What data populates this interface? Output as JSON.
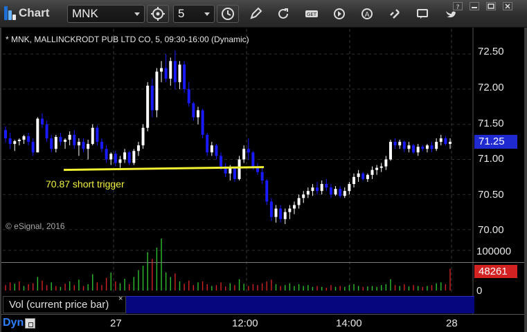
{
  "toolbar": {
    "title": "Chart",
    "symbol": "MNK",
    "interval": "5"
  },
  "colors": {
    "up_candle": "#ffffff",
    "down_candle": "#1a1aff",
    "trigger_line": "#f2f230",
    "vol_up": "#2fbf2f",
    "vol_down": "#d22222",
    "price_box": "#1f2bd0"
  },
  "chart": {
    "title": "* MNK, MALLINCKRODT PUB LTD CO, 5, 09:30-16:00 (Dynamic)",
    "watermark": "© eSignal, 2016",
    "annotation": "70.87 short trigger",
    "current_price": "71.25",
    "current_volume": "48261",
    "volume_panel_label": "Vol (current price bar)",
    "close_x": "×",
    "dyn_label": "Dyn",
    "price_ticks": [
      "72.50",
      "72.00",
      "71.50",
      "71.00",
      "70.50",
      "70.00"
    ],
    "volume_ticks": [
      "100000",
      "0"
    ],
    "x_ticks": [
      "27",
      "12:00",
      "14:00",
      "28"
    ]
  },
  "chart_data": {
    "type": "candlestick",
    "symbol": "MNK",
    "ylim": [
      70.0,
      72.6
    ],
    "trigger_level": 70.87,
    "bars": [
      [
        71.42,
        71.47,
        71.24,
        71.3
      ],
      [
        71.3,
        71.38,
        71.15,
        71.22
      ],
      [
        71.22,
        71.28,
        71.12,
        71.26
      ],
      [
        71.26,
        71.3,
        71.2,
        71.28
      ],
      [
        71.28,
        71.35,
        71.22,
        71.33
      ],
      [
        71.33,
        71.38,
        71.2,
        71.25
      ],
      [
        71.25,
        71.3,
        71.05,
        71.1
      ],
      [
        71.1,
        71.6,
        71.1,
        71.58
      ],
      [
        71.58,
        71.66,
        71.45,
        71.5
      ],
      [
        71.5,
        71.55,
        71.25,
        71.3
      ],
      [
        71.3,
        71.35,
        71.1,
        71.15
      ],
      [
        71.15,
        71.35,
        71.1,
        71.32
      ],
      [
        71.32,
        71.38,
        71.2,
        71.25
      ],
      [
        71.25,
        71.3,
        71.15,
        71.28
      ],
      [
        71.28,
        71.4,
        71.2,
        71.35
      ],
      [
        71.35,
        71.42,
        71.15,
        71.2
      ],
      [
        71.2,
        71.3,
        71.05,
        71.25
      ],
      [
        71.25,
        71.3,
        71.1,
        71.15
      ],
      [
        71.15,
        71.28,
        71.0,
        71.22
      ],
      [
        71.22,
        71.5,
        71.2,
        71.45
      ],
      [
        71.45,
        71.48,
        71.2,
        71.25
      ],
      [
        71.25,
        71.3,
        71.1,
        71.15
      ],
      [
        71.15,
        71.2,
        70.95,
        71.0
      ],
      [
        71.0,
        71.1,
        70.92,
        71.08
      ],
      [
        71.08,
        71.12,
        70.9,
        70.95
      ],
      [
        70.95,
        71.05,
        70.88,
        71.0
      ],
      [
        71.0,
        71.15,
        70.95,
        71.1
      ],
      [
        71.1,
        71.12,
        70.92,
        70.95
      ],
      [
        70.95,
        71.15,
        70.92,
        71.12
      ],
      [
        71.12,
        71.25,
        71.05,
        71.2
      ],
      [
        71.2,
        71.5,
        71.15,
        71.45
      ],
      [
        71.45,
        72.1,
        71.4,
        72.05
      ],
      [
        72.05,
        72.15,
        71.6,
        71.7
      ],
      [
        71.7,
        72.3,
        71.6,
        72.25
      ],
      [
        72.25,
        72.4,
        72.1,
        72.3
      ],
      [
        72.3,
        72.5,
        72.1,
        72.15
      ],
      [
        72.15,
        72.45,
        72.05,
        72.4
      ],
      [
        72.4,
        72.55,
        72.0,
        72.1
      ],
      [
        72.1,
        72.4,
        72.0,
        72.35
      ],
      [
        72.35,
        72.4,
        71.95,
        72.0
      ],
      [
        72.0,
        72.1,
        71.75,
        71.8
      ],
      [
        71.8,
        71.82,
        71.55,
        71.6
      ],
      [
        71.6,
        71.75,
        71.5,
        71.7
      ],
      [
        71.7,
        71.72,
        71.3,
        71.35
      ],
      [
        71.35,
        71.38,
        71.05,
        71.1
      ],
      [
        71.1,
        71.25,
        71.05,
        71.2
      ],
      [
        71.2,
        71.22,
        71.0,
        71.05
      ],
      [
        71.05,
        71.1,
        70.85,
        70.9
      ],
      [
        70.9,
        70.95,
        70.75,
        70.8
      ],
      [
        70.8,
        70.92,
        70.7,
        70.88
      ],
      [
        70.88,
        70.9,
        70.68,
        70.72
      ],
      [
        70.72,
        71.05,
        70.7,
        71.0
      ],
      [
        71.0,
        71.2,
        70.95,
        71.15
      ],
      [
        71.15,
        71.3,
        71.0,
        71.1
      ],
      [
        71.1,
        71.12,
        70.85,
        70.9
      ],
      [
        70.9,
        70.95,
        70.78,
        70.82
      ],
      [
        70.82,
        70.88,
        70.65,
        70.7
      ],
      [
        70.7,
        70.72,
        70.35,
        70.4
      ],
      [
        70.4,
        70.45,
        70.12,
        70.18
      ],
      [
        70.18,
        70.35,
        70.1,
        70.3
      ],
      [
        70.3,
        70.35,
        70.1,
        70.15
      ],
      [
        70.15,
        70.3,
        70.08,
        70.25
      ],
      [
        70.25,
        70.35,
        70.15,
        70.3
      ],
      [
        70.3,
        70.4,
        70.22,
        70.35
      ],
      [
        70.35,
        70.5,
        70.3,
        70.45
      ],
      [
        70.45,
        70.55,
        70.38,
        70.5
      ],
      [
        70.5,
        70.6,
        70.45,
        70.55
      ],
      [
        70.55,
        70.65,
        70.48,
        70.6
      ],
      [
        70.6,
        70.68,
        70.5,
        70.55
      ],
      [
        70.55,
        70.7,
        70.5,
        70.65
      ],
      [
        70.65,
        70.72,
        70.55,
        70.6
      ],
      [
        70.6,
        70.65,
        70.45,
        70.5
      ],
      [
        70.5,
        70.62,
        70.48,
        70.58
      ],
      [
        70.58,
        70.62,
        70.45,
        70.48
      ],
      [
        70.48,
        70.6,
        70.45,
        70.55
      ],
      [
        70.55,
        70.68,
        70.5,
        70.65
      ],
      [
        70.65,
        70.8,
        70.6,
        70.75
      ],
      [
        70.75,
        70.85,
        70.68,
        70.8
      ],
      [
        70.8,
        70.82,
        70.7,
        70.72
      ],
      [
        70.72,
        70.8,
        70.68,
        70.78
      ],
      [
        70.78,
        70.9,
        70.72,
        70.85
      ],
      [
        70.85,
        70.92,
        70.78,
        70.88
      ],
      [
        70.88,
        70.95,
        70.82,
        70.9
      ],
      [
        70.9,
        71.05,
        70.85,
        71.0
      ],
      [
        71.0,
        71.28,
        70.98,
        71.25
      ],
      [
        71.25,
        71.3,
        71.15,
        71.2
      ],
      [
        71.2,
        71.28,
        71.15,
        71.25
      ],
      [
        71.25,
        71.27,
        71.1,
        71.15
      ],
      [
        71.15,
        71.25,
        71.1,
        71.2
      ],
      [
        71.2,
        71.22,
        71.08,
        71.1
      ],
      [
        71.1,
        71.22,
        71.05,
        71.18
      ],
      [
        71.18,
        71.2,
        71.12,
        71.15
      ],
      [
        71.15,
        71.22,
        71.1,
        71.2
      ],
      [
        71.2,
        71.25,
        71.1,
        71.15
      ],
      [
        71.15,
        71.3,
        71.12,
        71.25
      ],
      [
        71.25,
        71.35,
        71.2,
        71.3
      ],
      [
        71.3,
        71.33,
        71.2,
        71.22
      ],
      [
        71.22,
        71.3,
        71.15,
        71.25
      ]
    ],
    "volume": [
      [
        12000,
        "d"
      ],
      [
        18000,
        "d"
      ],
      [
        15000,
        "u"
      ],
      [
        20000,
        "d"
      ],
      [
        10000,
        "u"
      ],
      [
        14000,
        "d"
      ],
      [
        16000,
        "d"
      ],
      [
        30000,
        "u"
      ],
      [
        22000,
        "d"
      ],
      [
        12000,
        "d"
      ],
      [
        18000,
        "u"
      ],
      [
        10000,
        "d"
      ],
      [
        8000,
        "u"
      ],
      [
        15000,
        "d"
      ],
      [
        20000,
        "u"
      ],
      [
        12000,
        "d"
      ],
      [
        24000,
        "u"
      ],
      [
        10000,
        "d"
      ],
      [
        14000,
        "u"
      ],
      [
        36000,
        "u"
      ],
      [
        18000,
        "d"
      ],
      [
        12000,
        "d"
      ],
      [
        28000,
        "d"
      ],
      [
        40000,
        "u"
      ],
      [
        20000,
        "d"
      ],
      [
        16000,
        "u"
      ],
      [
        26000,
        "u"
      ],
      [
        14000,
        "d"
      ],
      [
        30000,
        "u"
      ],
      [
        45000,
        "u"
      ],
      [
        55000,
        "u"
      ],
      [
        85000,
        "u"
      ],
      [
        70000,
        "d"
      ],
      [
        95000,
        "u"
      ],
      [
        115000,
        "u"
      ],
      [
        40000,
        "u"
      ],
      [
        30000,
        "u"
      ],
      [
        38000,
        "d"
      ],
      [
        20000,
        "u"
      ],
      [
        15000,
        "d"
      ],
      [
        22000,
        "d"
      ],
      [
        12000,
        "d"
      ],
      [
        18000,
        "u"
      ],
      [
        20000,
        "d"
      ],
      [
        14000,
        "d"
      ],
      [
        10000,
        "u"
      ],
      [
        12000,
        "d"
      ],
      [
        18000,
        "d"
      ],
      [
        9000,
        "d"
      ],
      [
        16000,
        "u"
      ],
      [
        12000,
        "d"
      ],
      [
        25000,
        "u"
      ],
      [
        15000,
        "u"
      ],
      [
        10000,
        "d"
      ],
      [
        14000,
        "d"
      ],
      [
        12000,
        "d"
      ],
      [
        16000,
        "d"
      ],
      [
        20000,
        "d"
      ],
      [
        24000,
        "d"
      ],
      [
        14000,
        "u"
      ],
      [
        10000,
        "d"
      ],
      [
        12000,
        "u"
      ],
      [
        16000,
        "u"
      ],
      [
        10000,
        "u"
      ],
      [
        14000,
        "u"
      ],
      [
        10000,
        "u"
      ],
      [
        12000,
        "u"
      ],
      [
        8000,
        "u"
      ],
      [
        10000,
        "d"
      ],
      [
        8000,
        "u"
      ],
      [
        6000,
        "d"
      ],
      [
        12000,
        "d"
      ],
      [
        8000,
        "u"
      ],
      [
        10000,
        "d"
      ],
      [
        8000,
        "u"
      ],
      [
        12000,
        "u"
      ],
      [
        14000,
        "u"
      ],
      [
        10000,
        "u"
      ],
      [
        8000,
        "d"
      ],
      [
        9000,
        "u"
      ],
      [
        10000,
        "u"
      ],
      [
        8000,
        "u"
      ],
      [
        12000,
        "u"
      ],
      [
        14000,
        "u"
      ],
      [
        25000,
        "u"
      ],
      [
        12000,
        "d"
      ],
      [
        10000,
        "u"
      ],
      [
        14000,
        "d"
      ],
      [
        9000,
        "u"
      ],
      [
        12000,
        "d"
      ],
      [
        10000,
        "u"
      ],
      [
        8000,
        "d"
      ],
      [
        10000,
        "u"
      ],
      [
        12000,
        "d"
      ],
      [
        16000,
        "u"
      ],
      [
        18000,
        "u"
      ],
      [
        14000,
        "d"
      ],
      [
        48261,
        "d"
      ]
    ],
    "volume_ylim": [
      0,
      115000
    ]
  }
}
